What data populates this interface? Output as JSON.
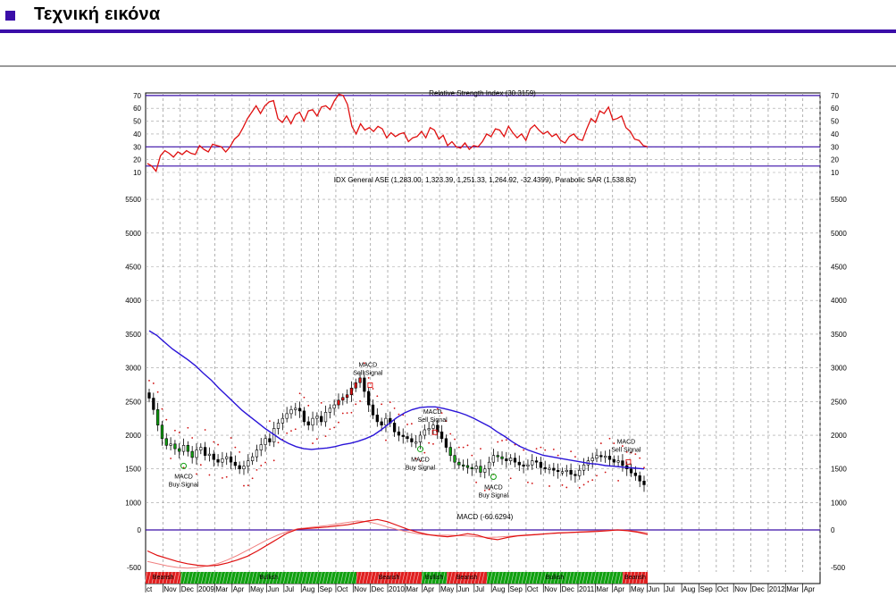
{
  "page": {
    "title": "Τεχνική εικόνα",
    "accent_color": "#3a0ea8",
    "icon": "square-bullet-icon"
  },
  "chart_data": [
    {
      "panel": "rsi",
      "type": "line",
      "title": "Relative Strength Index (30.3159)",
      "y_ticks": [
        70,
        60,
        50,
        40,
        30,
        20,
        10
      ],
      "ylim": [
        10,
        72
      ],
      "reference_lines": [
        70,
        30,
        15
      ],
      "reference_color": "#3a0ea8",
      "line_color": "#e01010",
      "values": [
        17,
        15,
        11,
        23,
        27,
        25,
        22,
        26,
        24,
        27,
        25,
        24,
        31,
        28,
        26,
        32,
        31,
        30,
        26,
        30,
        36,
        39,
        45,
        52,
        57,
        62,
        56,
        62,
        65,
        66,
        52,
        49,
        54,
        48,
        55,
        57,
        50,
        58,
        59,
        54,
        61,
        62,
        59,
        66,
        71,
        70,
        63,
        46,
        40,
        48,
        43,
        45,
        42,
        46,
        44,
        37,
        41,
        38,
        40,
        41,
        34,
        37,
        38,
        42,
        37,
        45,
        43,
        36,
        39,
        31,
        34,
        30,
        29,
        33,
        28,
        31,
        30,
        34,
        40,
        38,
        44,
        43,
        38,
        46,
        41,
        37,
        40,
        35,
        44,
        47,
        43,
        40,
        42,
        38,
        40,
        35,
        33,
        38,
        40,
        36,
        35,
        44,
        52,
        49,
        58,
        56,
        61,
        51,
        52,
        54,
        45,
        42,
        36,
        35,
        31,
        30
      ]
    },
    {
      "panel": "price",
      "type": "candlestick",
      "title": "IDX General ASE (1,283.00, 1,323.39, 1,251.33, 1,264.92, -32.4399), Parabolic SAR (1,538.82)",
      "y_ticks": [
        5500,
        5000,
        4500,
        4000,
        3500,
        3000,
        2500,
        2000,
        1500,
        1000
      ],
      "ylim": [
        820,
        5700
      ],
      "moving_average_color": "#2a14d8",
      "sar_color": "#d01010",
      "close": [
        2550,
        2380,
        2150,
        1950,
        1850,
        1870,
        1800,
        1760,
        1850,
        1760,
        1670,
        1780,
        1820,
        1700,
        1720,
        1640,
        1600,
        1650,
        1680,
        1600,
        1550,
        1500,
        1540,
        1620,
        1680,
        1780,
        1860,
        1950,
        1900,
        2100,
        2180,
        2250,
        2320,
        2380,
        2400,
        2360,
        2200,
        2150,
        2250,
        2280,
        2200,
        2340,
        2400,
        2450,
        2520,
        2560,
        2600,
        2700,
        2780,
        2850,
        2650,
        2450,
        2300,
        2200,
        2150,
        2250,
        2180,
        2050,
        2000,
        1980,
        1950,
        1900,
        1900,
        2000,
        2080,
        2100,
        2150,
        2050,
        1950,
        1820,
        1700,
        1600,
        1560,
        1550,
        1520,
        1500,
        1540,
        1450,
        1500,
        1600,
        1700,
        1680,
        1650,
        1620,
        1660,
        1600,
        1560,
        1540,
        1560,
        1620,
        1600,
        1520,
        1500,
        1510,
        1480,
        1460,
        1460,
        1480,
        1420,
        1400,
        1480,
        1560,
        1620,
        1660,
        1700,
        1680,
        1690,
        1640,
        1600,
        1620,
        1550,
        1500,
        1440,
        1400,
        1320,
        1265
      ],
      "moving_average": [
        3550,
        3480,
        3380,
        3280,
        3200,
        3120,
        3030,
        2920,
        2820,
        2700,
        2590,
        2480,
        2370,
        2280,
        2190,
        2100,
        2020,
        1940,
        1880,
        1830,
        1800,
        1790,
        1800,
        1810,
        1830,
        1860,
        1880,
        1910,
        1950,
        2000,
        2080,
        2170,
        2260,
        2330,
        2380,
        2410,
        2420,
        2420,
        2400,
        2370,
        2340,
        2300,
        2250,
        2190,
        2130,
        2050,
        1980,
        1900,
        1830,
        1780,
        1740,
        1700,
        1680,
        1660,
        1640,
        1620,
        1600,
        1580,
        1570,
        1550,
        1540,
        1530,
        1520,
        1510,
        1500
      ],
      "ma_x": [
        0,
        2,
        4,
        6,
        8,
        10,
        12,
        14,
        16,
        18,
        20,
        22,
        24,
        26,
        28,
        30,
        32,
        34,
        36,
        38,
        40,
        42,
        44,
        46,
        48,
        50,
        52,
        54,
        56,
        58,
        60,
        62,
        64,
        66,
        68,
        70,
        72,
        74,
        76,
        78,
        80,
        82,
        84,
        86,
        88,
        90,
        92,
        94,
        96,
        98,
        100,
        102,
        104,
        106,
        108,
        110,
        112,
        114,
        116,
        118,
        120,
        122,
        124,
        126,
        128
      ],
      "signals": [
        {
          "label_line1": "MACD",
          "label_line2": "Buy Signal",
          "kind": "buy",
          "index": 8,
          "value": 1650
        },
        {
          "label_line1": "MACD",
          "label_line2": "Sell Signal",
          "kind": "sell",
          "index": 50,
          "value": 2750
        },
        {
          "label_line1": "MACD",
          "label_line2": "Sell Signal",
          "kind": "sell",
          "index": 65,
          "value": 2050
        },
        {
          "label_line1": "MACD",
          "label_line2": "Buy Signal",
          "kind": "buy",
          "index": 63,
          "value": 1900
        },
        {
          "label_line1": "MACD",
          "label_line2": "Buy Signal",
          "kind": "buy",
          "index": 80,
          "value": 1490
        },
        {
          "label_line1": "MACD",
          "label_line2": "Sell Signal",
          "kind": "sell",
          "index": 110,
          "value": 1610
        }
      ]
    },
    {
      "panel": "macd",
      "type": "line",
      "title": "MACD (-60.6294)",
      "y_ticks": [
        0,
        -500
      ],
      "ylim": [
        -560,
        60
      ],
      "macd": [
        -280,
        -340,
        -380,
        -420,
        -450,
        -470,
        -480,
        -470,
        -440,
        -400,
        -350,
        -280,
        -200,
        -120,
        -40,
        10,
        20,
        30,
        40,
        55,
        70,
        95,
        120,
        140,
        110,
        60,
        10,
        -30,
        -60,
        -80,
        -90,
        -75,
        -50,
        -70,
        -110,
        -130,
        -100,
        -80,
        -70,
        -60,
        -50,
        -40,
        -35,
        -30,
        -25,
        -20,
        -10,
        0,
        -10,
        -30,
        -60
      ],
      "signal": [
        -420,
        -450,
        -480,
        -500,
        -510,
        -500,
        -480,
        -450,
        -400,
        -340,
        -270,
        -200,
        -130,
        -70,
        -20,
        15,
        30,
        45,
        60,
        80,
        100,
        120,
        110,
        80,
        40,
        5,
        -25,
        -50,
        -65,
        -70,
        -70,
        -75,
        -80,
        -90,
        -100,
        -95,
        -85,
        -75,
        -65,
        -58,
        -50,
        -42,
        -35,
        -28,
        -20,
        -12,
        -5,
        0,
        -5,
        -20,
        -40
      ],
      "line_color": "#e01010",
      "zero_line_color": "#3a0ea8"
    }
  ],
  "trend_bar": {
    "segments": [
      {
        "label": "Bearish",
        "color": "#e02020",
        "from": 0.0,
        "to": 0.07
      },
      {
        "label": "Bullish",
        "color": "#10a010",
        "from": 0.07,
        "to": 0.42
      },
      {
        "label": "Bearish",
        "color": "#e02020",
        "from": 0.42,
        "to": 0.55
      },
      {
        "label": "Bullish",
        "color": "#10a010",
        "from": 0.55,
        "to": 0.6
      },
      {
        "label": "Bearish",
        "color": "#e02020",
        "from": 0.6,
        "to": 0.68
      },
      {
        "label": "Bullish",
        "color": "#10a010",
        "from": 0.68,
        "to": 0.95
      },
      {
        "label": "Bearish",
        "color": "#e02020",
        "from": 0.95,
        "to": 1.0
      }
    ]
  },
  "x_labels": [
    "ct",
    "Nov",
    "Dec",
    "2009",
    "Mar",
    "Apr",
    "May",
    "Jun",
    "Jul",
    "Aug",
    "Sep",
    "Oct",
    "Nov",
    "Dec",
    "2010",
    "Mar",
    "Apr",
    "May",
    "Jun",
    "Jul",
    "Aug",
    "Sep",
    "Oct",
    "Nov",
    "Dec",
    "2011",
    "Mar",
    "Apr",
    "May",
    "Jun",
    "Jul",
    "Aug",
    "Sep",
    "Oct",
    "Nov",
    "Dec",
    "2012",
    "Mar",
    "Apr"
  ]
}
